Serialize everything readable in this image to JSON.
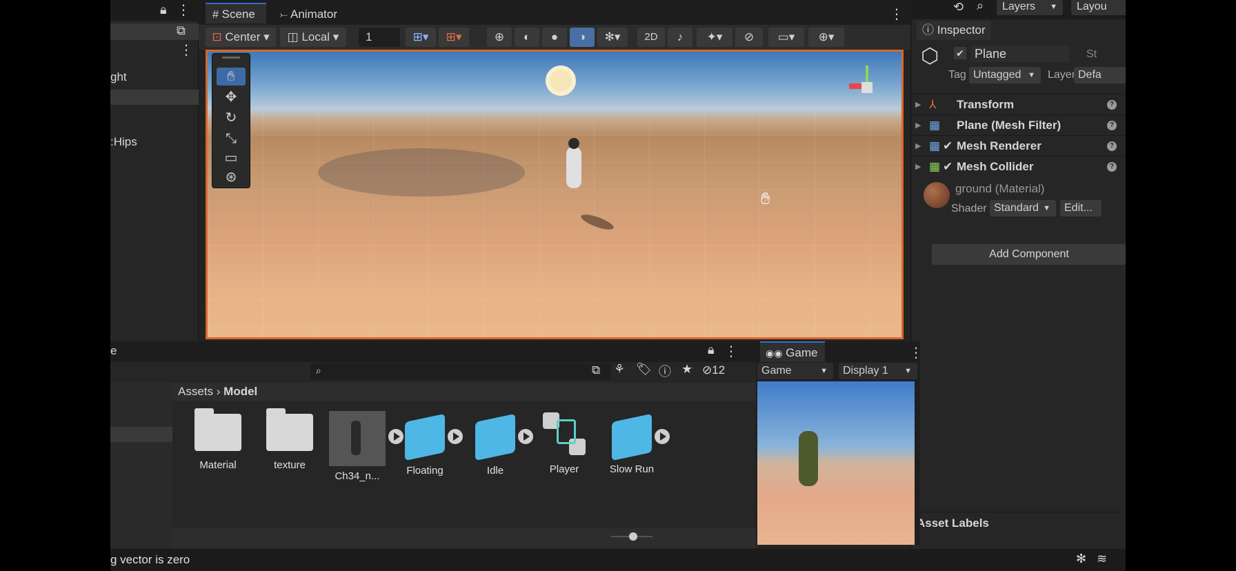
{
  "scene_tabs": {
    "scene": "Scene",
    "animator": "Animator"
  },
  "top_right": {
    "layers": "Layers",
    "layout": "Layou"
  },
  "hierarchy": {
    "item_light": "ght",
    "item_hips": ":Hips"
  },
  "scene_toolbar": {
    "pivot": "Center",
    "space": "Local",
    "grid_value": "1",
    "mode_2d": "2D"
  },
  "inspector": {
    "tab": "Inspector",
    "object_name": "Plane",
    "static_label": "St",
    "tag_label": "Tag",
    "tag_value": "Untagged",
    "layer_label": "Layer",
    "layer_value": "Defa",
    "components": [
      "Transform",
      "Plane (Mesh Filter)",
      "Mesh Renderer",
      "Mesh Collider"
    ],
    "material": "ground (Material)",
    "shader_label": "Shader",
    "shader_value": "Standard",
    "edit_label": "Edit...",
    "add_component": "Add Component",
    "asset_labels": "Asset Labels"
  },
  "project": {
    "tab_fragment": "e",
    "hidden_count": "12",
    "breadcrumb": [
      "Assets",
      "Model"
    ],
    "assets": [
      "Material",
      "texture",
      "Ch34_n...",
      "Floating",
      "Idle",
      "Player",
      "Slow Run"
    ]
  },
  "game_view": {
    "tab": "Game",
    "mode": "Game",
    "display": "Display 1"
  },
  "status": {
    "message": "g vector is zero"
  },
  "colors": {
    "accent": "#2c6fcf",
    "viewport_border": "#d8672c",
    "cube_blue": "#4fb7e6"
  }
}
